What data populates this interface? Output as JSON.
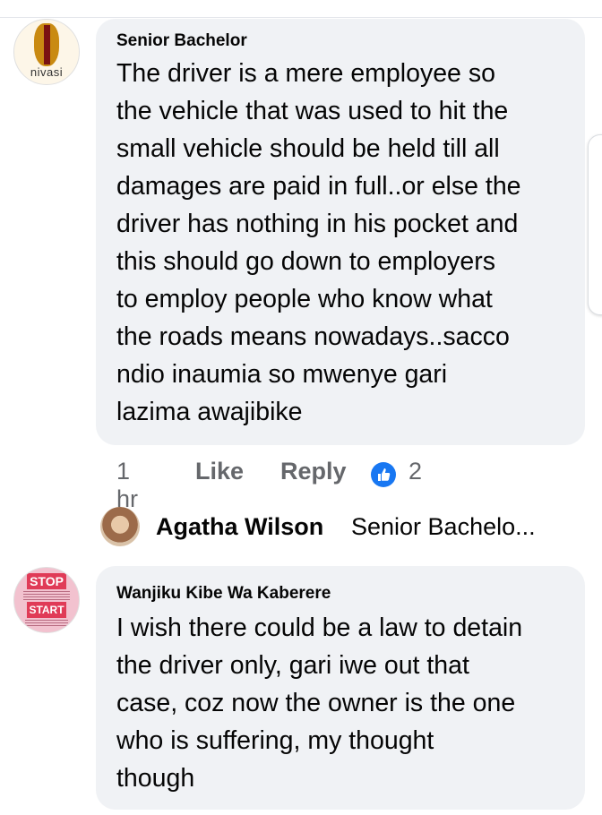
{
  "comments": [
    {
      "author": "Senior Bachelor",
      "avatar_text": "nivasi",
      "text_lines": [
        "The driver is a mere employee so",
        "the vehicle that was used to hit the",
        "small vehicle should be held till all",
        "damages are paid in full..or else the",
        "driver has nothing in his pocket and",
        "this should go down to employers",
        "to employ people who know what",
        "the roads means nowadays..sacco",
        "ndio inaumia so mwenye gari",
        "lazima awajibike"
      ],
      "time": "1 hr",
      "like_label": "Like",
      "reply_label": "Reply",
      "reaction_count": "2",
      "reply_preview": {
        "author": "Agatha Wilson",
        "text": "Senior Bachelo..."
      }
    },
    {
      "author": "Wanjiku Kibe Wa Kaberere",
      "avatar_text_top": "STOP",
      "avatar_text_bottom": "START",
      "text_lines": [
        "I wish there could be a law to detain",
        "the driver only, gari iwe out that",
        "case, coz now the owner is the one",
        "who is suffering, my thought",
        "though"
      ]
    }
  ],
  "colors": {
    "bubble": "#f0f2f5",
    "meta": "#65676b",
    "like_blue": "#1877f2"
  }
}
